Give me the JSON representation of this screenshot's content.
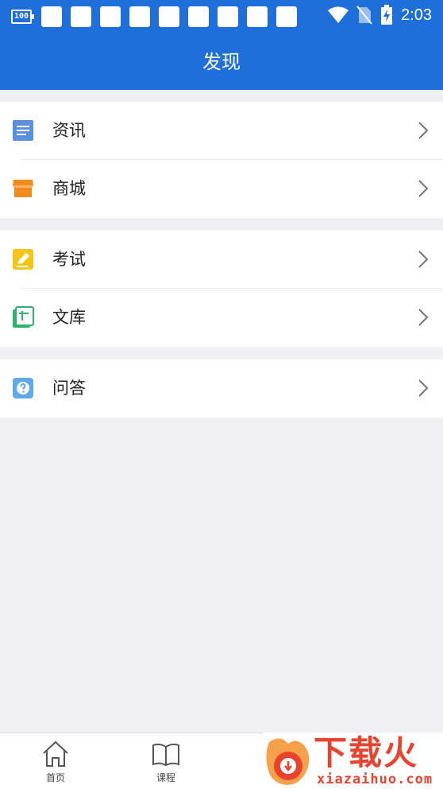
{
  "status_bar": {
    "battery_badge": "100",
    "notification_icon_count": 9,
    "time": "2:03",
    "icons": [
      "wifi-icon",
      "no-sim-icon",
      "battery-charging-icon"
    ]
  },
  "header": {
    "title": "发现"
  },
  "groups": [
    {
      "items": [
        {
          "label": "资讯",
          "icon": "news-icon",
          "color": "#5b8fe0"
        },
        {
          "label": "商城",
          "icon": "store-icon",
          "color": "#f28b1d"
        }
      ]
    },
    {
      "items": [
        {
          "label": "考试",
          "icon": "exam-pencil-icon",
          "color": "#f5c518"
        },
        {
          "label": "文库",
          "icon": "library-book-icon",
          "color": "#2fb36b"
        }
      ]
    },
    {
      "items": [
        {
          "label": "问答",
          "icon": "question-icon",
          "color": "#5ea9e6"
        }
      ]
    }
  ],
  "tabbar": {
    "tabs": [
      {
        "label": "首页",
        "icon": "home-icon"
      },
      {
        "label": "课程",
        "icon": "book-open-icon"
      }
    ]
  },
  "watermark": {
    "text": "下载火",
    "url": "xiazaihuo.com",
    "color": "#e8432f"
  },
  "colors": {
    "header": "#1e6fd9",
    "background": "#efeff4"
  }
}
